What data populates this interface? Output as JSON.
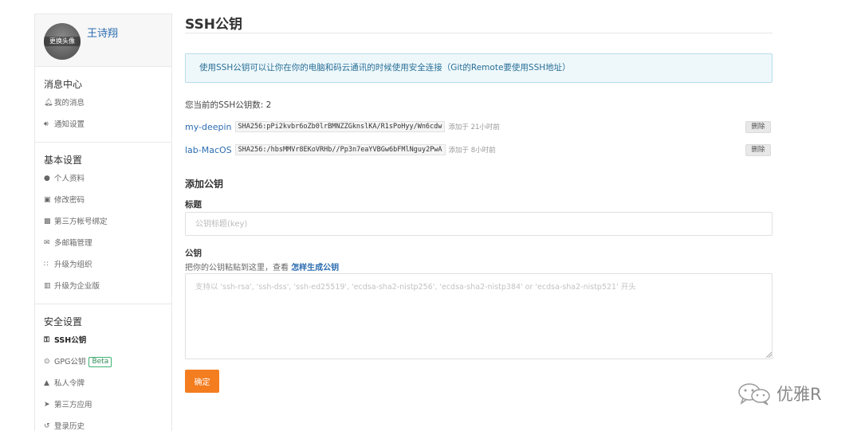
{
  "user": {
    "name": "王诗翔",
    "avatar_label": "更换头像"
  },
  "sidebar": {
    "sections": [
      {
        "title": "消息中心",
        "items": [
          {
            "label": "我的消息",
            "icon": "bell-icon"
          },
          {
            "label": "通知设置",
            "icon": "speaker-icon"
          }
        ]
      },
      {
        "title": "基本设置",
        "items": [
          {
            "label": "个人资料",
            "icon": "user-icon"
          },
          {
            "label": "修改密码",
            "icon": "lock-icon"
          },
          {
            "label": "第三方帐号绑定",
            "icon": "link-icon"
          },
          {
            "label": "多邮箱管理",
            "icon": "envelope-icon"
          },
          {
            "label": "升级为组织",
            "icon": "group-icon"
          },
          {
            "label": "升级为企业版",
            "icon": "building-icon"
          }
        ]
      },
      {
        "title": "安全设置",
        "items": [
          {
            "label": "SSH公钥",
            "icon": "key-icon",
            "active": true
          },
          {
            "label": "GPG公钥",
            "icon": "fingerprint-icon",
            "badge": "Beta"
          },
          {
            "label": "私人令牌",
            "icon": "token-icon"
          },
          {
            "label": "第三方应用",
            "icon": "rocket-icon"
          },
          {
            "label": "登录历史",
            "icon": "history-icon"
          }
        ]
      }
    ]
  },
  "main": {
    "title": "SSH公钥",
    "info": "使用SSH公钥可以让你在你的电脑和码云通讯的时候使用安全连接（Git的Remote要使用SSH地址）",
    "key_count_text": "您当前的SSH公钥数: 2",
    "keys": [
      {
        "name": "my-deepin",
        "fingerprint": "SHA256:pPi2kvbr6oZb0lrBMNZZGknslKA/R1sPoHyy/Wn6cdw",
        "added": "添加于 21小时前",
        "delete_label": "删除"
      },
      {
        "name": "lab-MacOS",
        "fingerprint": "SHA256:/hbsMMVr8EKoVRHb//Pp3n7eaYVBGw6bFMlNguy2PwA",
        "added": "添加于 8小时前",
        "delete_label": "删除"
      }
    ],
    "add_heading": "添加公钥",
    "title_label": "标题",
    "title_placeholder": "公钥标题(key)",
    "key_label": "公钥",
    "hint_prefix": "把你的公钥粘贴到这里，查看 ",
    "hint_link": "怎样生成公钥",
    "key_placeholder": "支持以 'ssh-rsa', 'ssh-dss', 'ssh-ed25519', 'ecdsa-sha2-nistp256', 'ecdsa-sha2-nistp384' or 'ecdsa-sha2-nistp521' 开头",
    "submit_label": "确定"
  },
  "watermark": {
    "text": "优雅R",
    "icon": "wechat-icon"
  },
  "colors": {
    "link": "#2b6cb0",
    "accent": "#f47d20",
    "info_bg": "#eef8fb",
    "info_border": "#b8dcea",
    "beta": "#3cb371"
  }
}
